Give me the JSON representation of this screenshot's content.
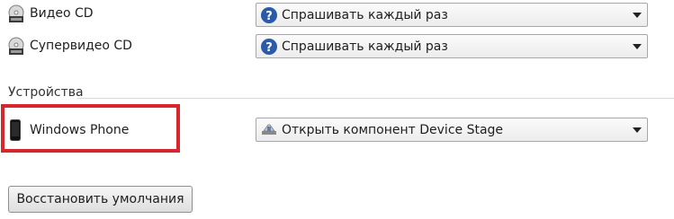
{
  "media_rows": [
    {
      "label": "Видео CD",
      "action": "Спрашивать каждый раз",
      "icon": "video-cd-icon"
    },
    {
      "label": "Супервидео CD",
      "action": "Спрашивать каждый раз",
      "icon": "svcd-icon"
    }
  ],
  "devices_section": {
    "title": "Устройства",
    "device": {
      "label": "Windows Phone",
      "action": "Открыть компонент Device Stage",
      "icon": "phone-icon",
      "action_icon": "device-stage-icon"
    }
  },
  "restore_button_label": "Восстановить умолчания",
  "colors": {
    "highlight": "#d9262c",
    "question_icon": "#2a5aa8"
  }
}
